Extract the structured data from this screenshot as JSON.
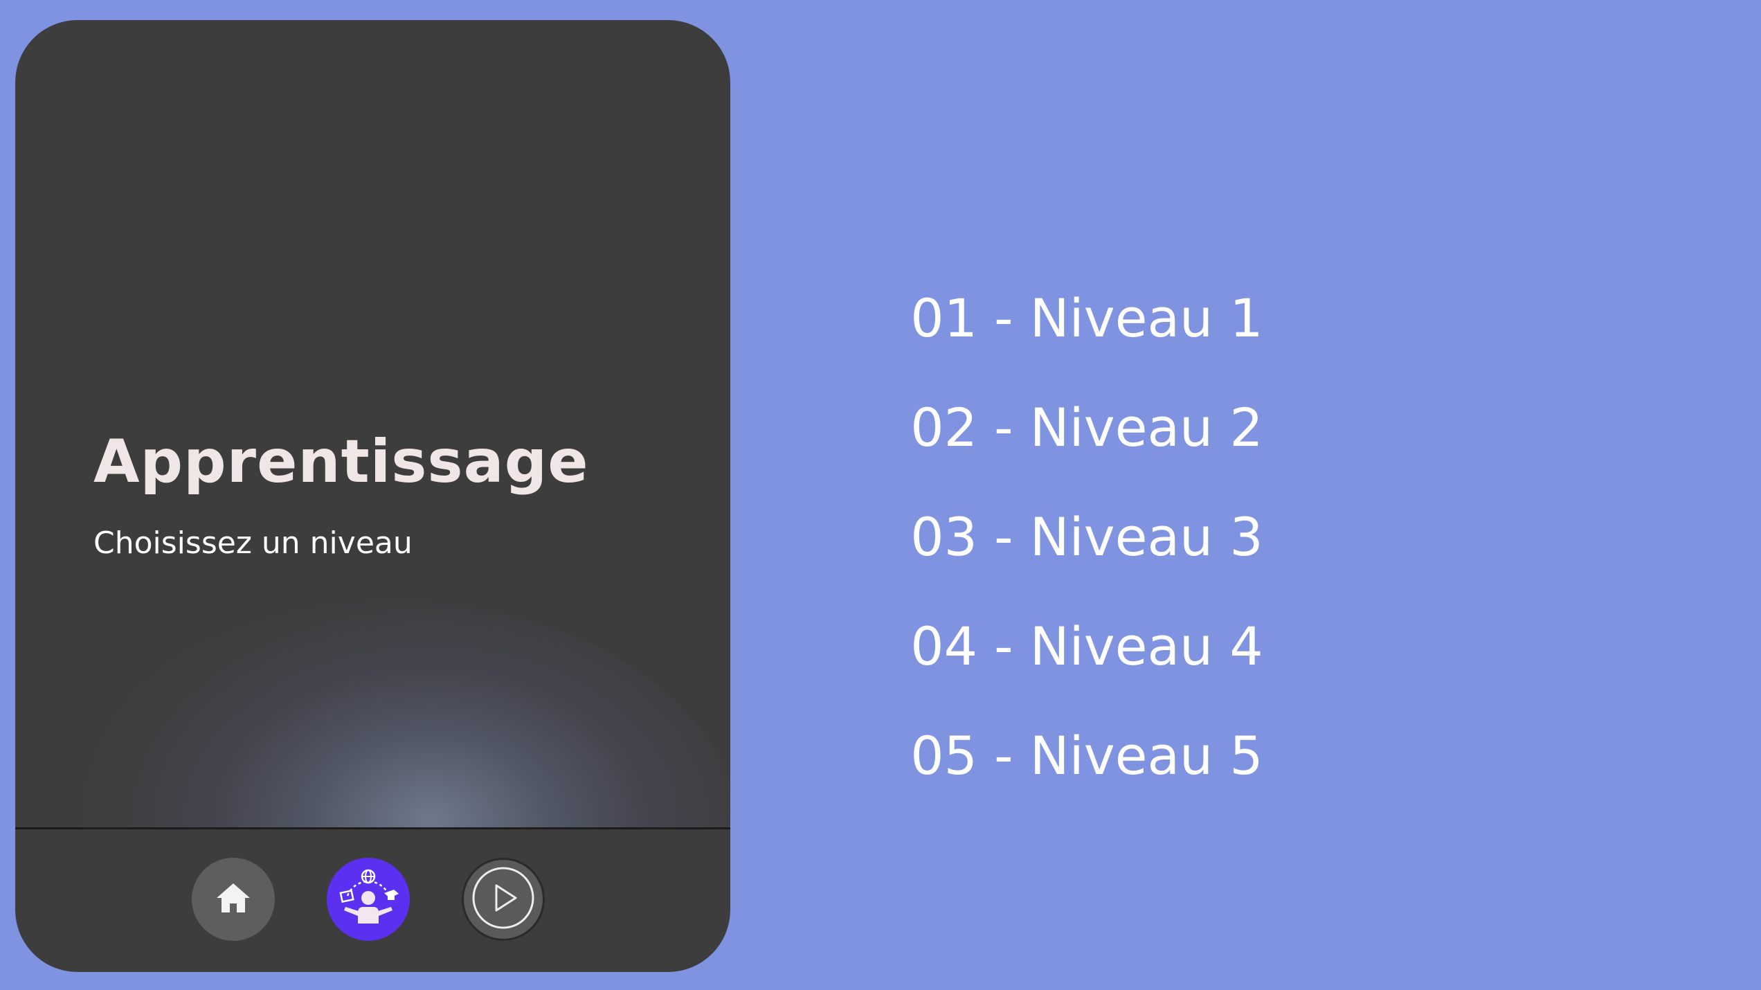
{
  "card": {
    "title": "Apprentissage",
    "subtitle": "Choisissez un niveau"
  },
  "nav": {
    "items": [
      {
        "name": "home",
        "icon": "home-icon"
      },
      {
        "name": "learning",
        "icon": "learning-person-icon",
        "active": true
      },
      {
        "name": "play",
        "icon": "play-icon"
      }
    ]
  },
  "levels": [
    {
      "label": "01 - Niveau 1"
    },
    {
      "label": "02 - Niveau 2"
    },
    {
      "label": "03 - Niveau 3"
    },
    {
      "label": "04 - Niveau 4"
    },
    {
      "label": "05 - Niveau 5"
    }
  ],
  "colors": {
    "background": "#7f93e1",
    "card": "#3d3d3d",
    "accent": "#5b30f0",
    "title": "#f1e6e6",
    "text": "#ffffff"
  }
}
